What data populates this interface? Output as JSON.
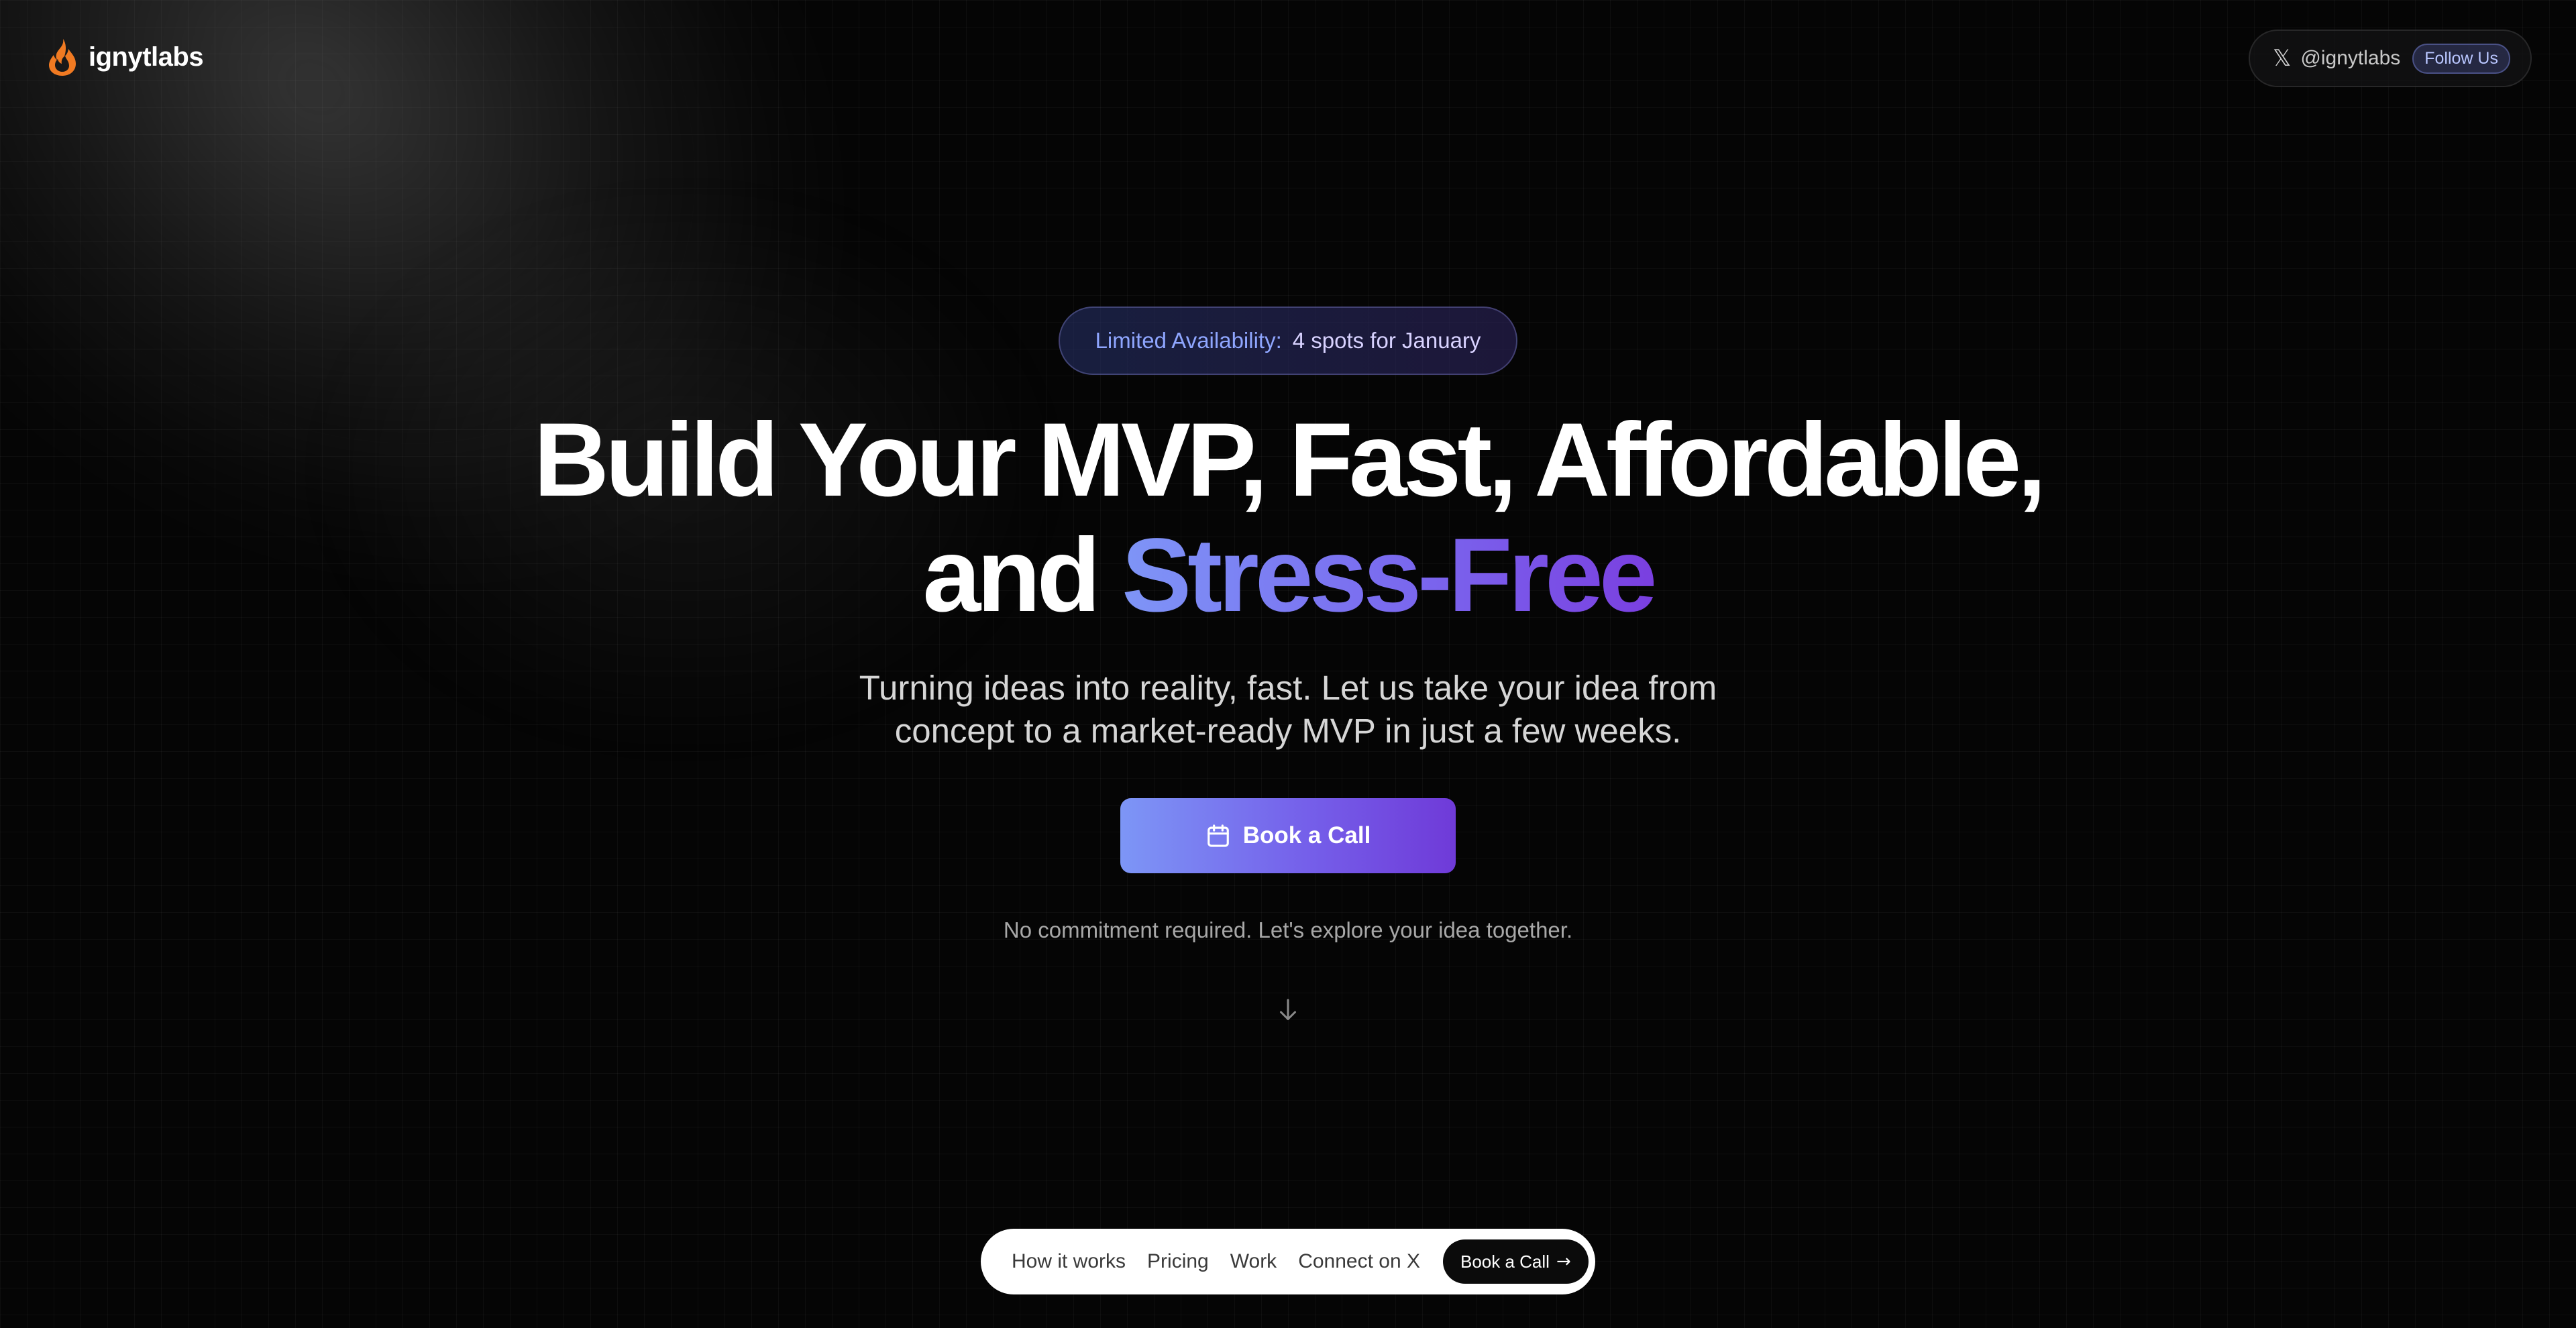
{
  "brand": {
    "name": "ignytlabs",
    "icon": "flame-icon",
    "accent_color": "#f07a22"
  },
  "social": {
    "icon": "x-logo-icon",
    "handle": "@ignytlabs",
    "follow_label": "Follow Us"
  },
  "hero": {
    "availability_label": "Limited Availability:",
    "availability_value": "4 spots for January",
    "headline_line1": "Build Your MVP, Fast, Affordable,",
    "headline_line2_plain": "and ",
    "headline_line2_accent": "Stress-Free",
    "subtitle_line1": "Turning ideas into reality, fast. Let us take your idea from",
    "subtitle_line2": "concept to a market-ready MVP in just a few weeks.",
    "cta_label": "Book a Call",
    "cta_icon": "calendar-icon",
    "note": "No commitment required. Let's explore your idea together.",
    "scroll_icon": "arrow-down-icon"
  },
  "bottom_nav": {
    "links": [
      "How it works",
      "Pricing",
      "Work",
      "Connect on X"
    ],
    "cta_label": "Book a Call",
    "cta_icon": "arrow-right-icon"
  },
  "colors": {
    "background": "#050505",
    "accent_gradient_start": "#7e95f7",
    "accent_gradient_end": "#7a3fe0",
    "availability_label": "#8fa6ff"
  }
}
